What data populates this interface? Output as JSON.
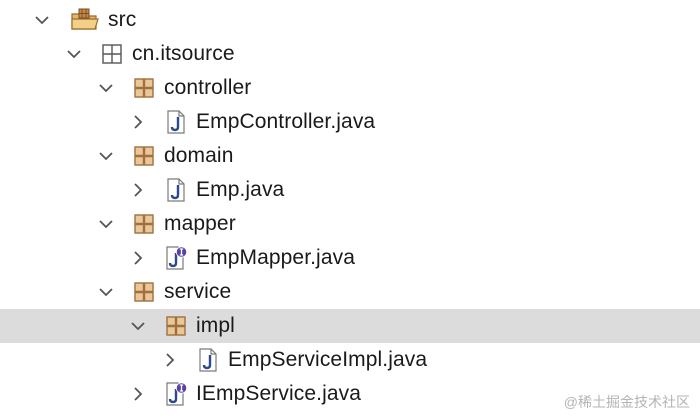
{
  "tree": {
    "rows": [
      {
        "label": "src",
        "icon": "source-folder-icon",
        "expanded": true
      },
      {
        "label": "cn.itsource",
        "icon": "package-icon",
        "expanded": true
      },
      {
        "label": "controller",
        "icon": "package-icon",
        "expanded": true
      },
      {
        "label": "EmpController.java",
        "icon": "java-class-file-icon",
        "expanded": false
      },
      {
        "label": "domain",
        "icon": "package-icon",
        "expanded": true
      },
      {
        "label": "Emp.java",
        "icon": "java-class-file-icon",
        "expanded": false
      },
      {
        "label": "mapper",
        "icon": "package-icon",
        "expanded": true
      },
      {
        "label": "EmpMapper.java",
        "icon": "java-interface-file-icon",
        "expanded": false
      },
      {
        "label": "service",
        "icon": "package-icon",
        "expanded": true
      },
      {
        "label": "impl",
        "icon": "package-icon",
        "expanded": true,
        "selected": true
      },
      {
        "label": "EmpServiceImpl.java",
        "icon": "java-class-file-icon",
        "expanded": false
      },
      {
        "label": "IEmpService.java",
        "icon": "java-interface-file-icon",
        "expanded": false
      }
    ]
  },
  "watermark": "@稀土掘金技术社区",
  "colors": {
    "selection": "#dcdcdc",
    "package_brown": "#a0703c",
    "package_fill": "#e9c79a",
    "java_blue": "#2b4a8b",
    "folder_tan": "#e2b66b"
  }
}
